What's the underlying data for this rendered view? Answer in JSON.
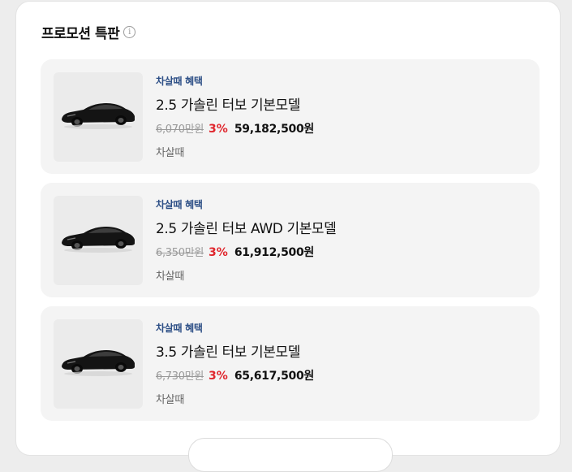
{
  "promo": {
    "title": "프로모션 특판",
    "info_icon": "i"
  },
  "products": [
    {
      "benefit": "차살때 혜택",
      "model": "2.5 가솔린 터보 기본모델",
      "original_price": "6,070만원",
      "discount": "3%",
      "final_price": "59,182,500원",
      "tag": "차살때"
    },
    {
      "benefit": "차살때 혜택",
      "model": "2.5 가솔린 터보 AWD 기본모델",
      "original_price": "6,350만원",
      "discount": "3%",
      "final_price": "61,912,500원",
      "tag": "차살때"
    },
    {
      "benefit": "차살때 혜택",
      "model": "3.5 가솔린 터보 기본모델",
      "original_price": "6,730만원",
      "discount": "3%",
      "final_price": "65,617,500원",
      "tag": "차살때"
    }
  ],
  "colors": {
    "benefit": "#2d4f86",
    "discount": "#e0262d",
    "card_bg": "#f4f4f4"
  }
}
